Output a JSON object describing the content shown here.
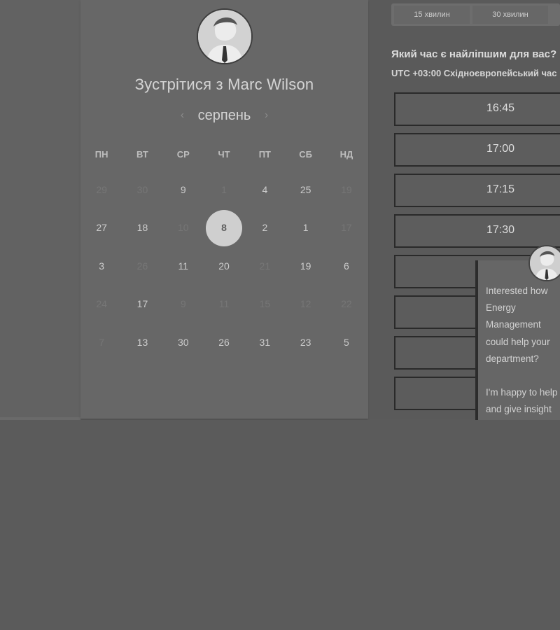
{
  "title": "Зустрітися з Marc Wilson",
  "month": "серпень",
  "weekdays": [
    "ПН",
    "ВТ",
    "СР",
    "ЧТ",
    "ПТ",
    "СБ",
    "НД"
  ],
  "weeks": [
    [
      "29",
      "30",
      "9",
      "1",
      "4",
      "25",
      "19"
    ],
    [
      "27",
      "18",
      "10",
      "8",
      "2",
      "1",
      "17"
    ],
    [
      "3",
      "26",
      "11",
      "20",
      "21",
      "19",
      "6"
    ],
    [
      "24",
      "17",
      "9",
      "11",
      "15",
      "12",
      "22"
    ],
    [
      "7",
      "13",
      "30",
      "26",
      "31",
      "23",
      "5"
    ]
  ],
  "dim_days": [
    [
      0,
      0
    ],
    [
      0,
      1
    ],
    [
      0,
      3
    ],
    [
      0,
      6
    ],
    [
      1,
      2
    ],
    [
      1,
      6
    ],
    [
      2,
      1
    ],
    [
      2,
      4
    ],
    [
      3,
      0
    ],
    [
      3,
      2
    ],
    [
      3,
      3
    ],
    [
      3,
      4
    ],
    [
      3,
      5
    ],
    [
      3,
      6
    ],
    [
      4,
      0
    ]
  ],
  "selected_day": [
    1,
    3
  ],
  "durations": [
    "15 хвилин",
    "30 хвилин",
    ""
  ],
  "question": "Який час є найліпшим для вас?",
  "timezone": "UTC +03:00 Східноєвропейський час",
  "slots": [
    "16:45",
    "17:00",
    "17:15",
    "17:30",
    "",
    "",
    "",
    ""
  ],
  "popup_message": "Interested how Energy Management could help your department?\n\nI'm happy to help and give insight into how customers use our platform for improvement in team productivity.",
  "colors": {
    "selected": "#cfcfcf",
    "text": "#d4d4d4"
  }
}
